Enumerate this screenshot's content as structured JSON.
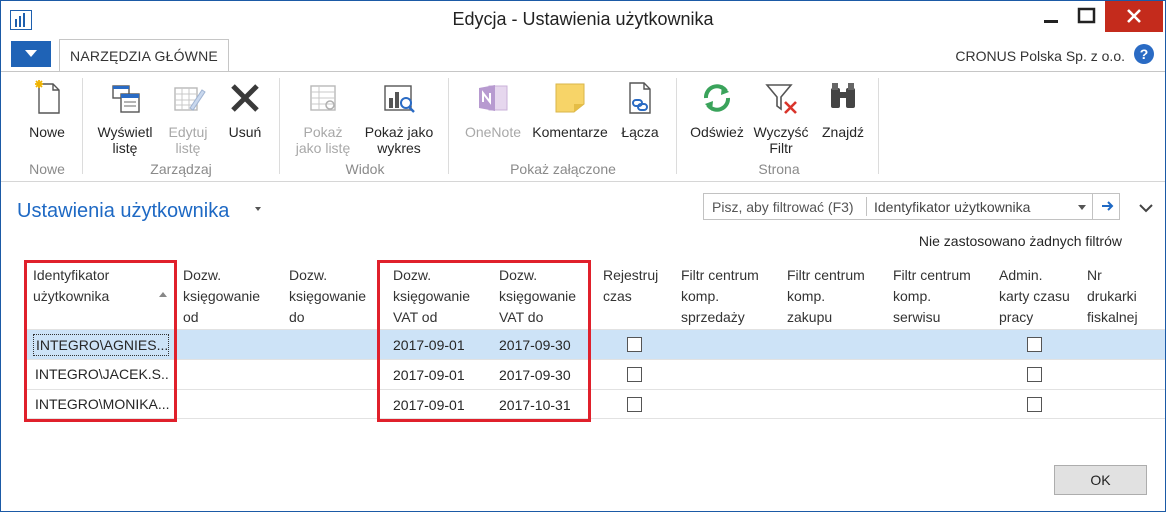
{
  "window": {
    "title": "Edycja - Ustawienia użytkownika"
  },
  "ribbon": {
    "tab_home": "NARZĘDZIA GŁÓWNE",
    "company": "CRONUS Polska Sp. z o.o.",
    "help": "?",
    "buttons": {
      "new": "Nowe",
      "view_list": [
        "Wyświetl",
        "listę"
      ],
      "edit_list": [
        "Edytuj",
        "listę"
      ],
      "delete": "Usuń",
      "show_as_list": [
        "Pokaż",
        "jako listę"
      ],
      "show_as_chart": [
        "Pokaż jako",
        "wykres"
      ],
      "onenote": "OneNote",
      "notes": "Komentarze",
      "links": "Łącza",
      "refresh": "Odśwież",
      "clear_filter": [
        "Wyczyść",
        "Filtr"
      ],
      "find": "Znajdź"
    },
    "groups": {
      "new": "Nowe",
      "manage": "Zarządzaj",
      "view": "Widok",
      "show_attached": "Pokaż załączone",
      "page": "Strona"
    }
  },
  "page": {
    "title": "Ustawienia użytkownika",
    "filter_placeholder": "Pisz, aby filtrować (F3)",
    "filter_field": "Identyfikator użytkownika",
    "no_filters": "Nie zastosowano żadnych filtrów"
  },
  "grid": {
    "columns": [
      [
        "Identyfikator",
        "użytkownika"
      ],
      [
        "Dozw.",
        "księgowanie",
        "od"
      ],
      [
        "Dozw.",
        "księgowanie",
        "do"
      ],
      [
        "Dozw.",
        "księgowanie",
        "VAT od"
      ],
      [
        "Dozw.",
        "księgowanie",
        "VAT do"
      ],
      [
        "Rejestruj",
        "czas"
      ],
      [
        "Filtr centrum",
        "komp.",
        "sprzedaży"
      ],
      [
        "Filtr centrum",
        "komp.",
        "zakupu"
      ],
      [
        "Filtr centrum",
        "komp.",
        "serwisu"
      ],
      [
        "Admin.",
        "karty czasu",
        "pracy"
      ],
      [
        "Nr",
        "drukarki",
        "fiskalnej"
      ]
    ],
    "rows": [
      {
        "user_id": "INTEGRO\\AGNIES...",
        "vat_from": "2017-09-01",
        "vat_to": "2017-09-30",
        "register_time": false,
        "timesheet_admin": false
      },
      {
        "user_id": "INTEGRO\\JACEK.S...",
        "vat_from": "2017-09-01",
        "vat_to": "2017-09-30",
        "register_time": false,
        "timesheet_admin": false
      },
      {
        "user_id": "INTEGRO\\MONIKA...",
        "vat_from": "2017-09-01",
        "vat_to": "2017-10-31",
        "register_time": false,
        "timesheet_admin": false
      }
    ]
  },
  "footer": {
    "ok": "OK"
  },
  "colors": {
    "accent": "#1e69c4",
    "highlight": "#e0202b",
    "selected_row": "#cde3f7"
  }
}
